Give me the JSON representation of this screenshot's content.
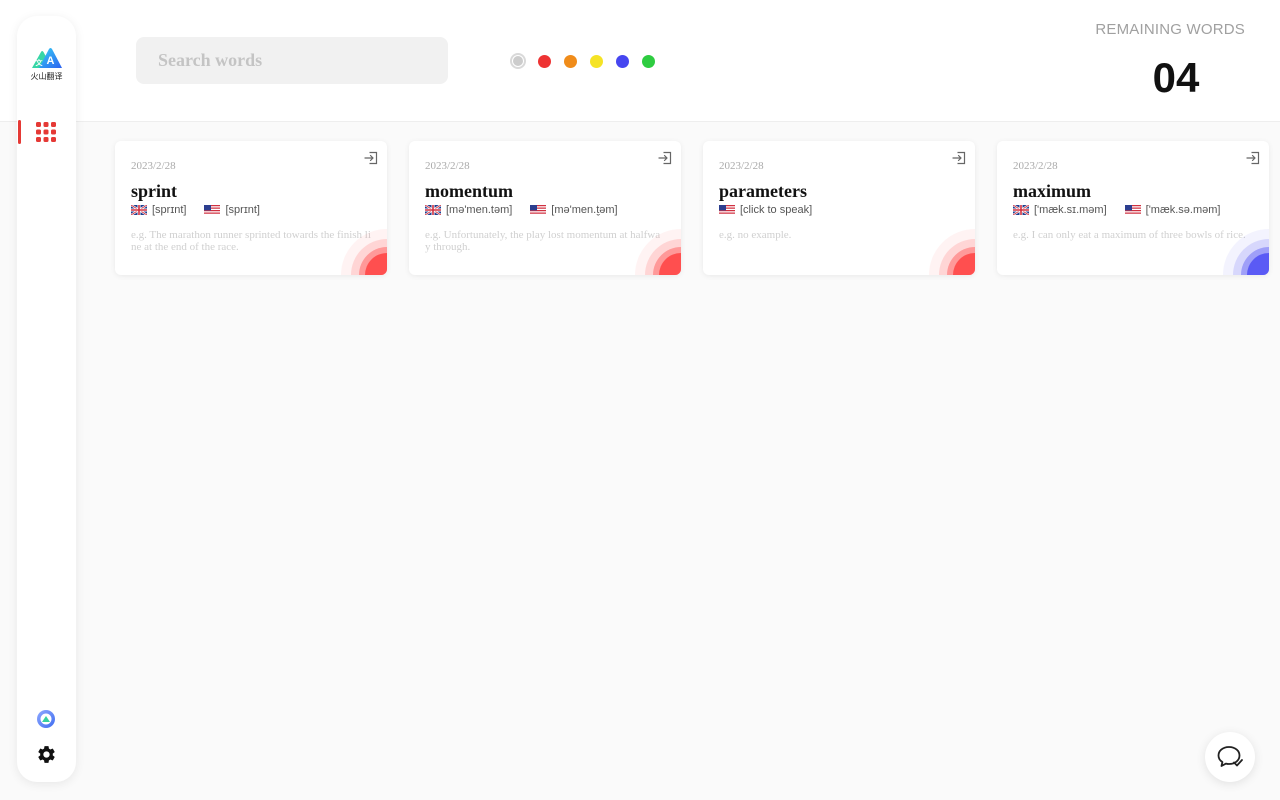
{
  "app": {
    "logo_text": "火山翻译"
  },
  "search": {
    "placeholder": "Search words",
    "value": ""
  },
  "color_filters": [
    {
      "name": "all",
      "color": "#cccccc",
      "selected": true
    },
    {
      "name": "red",
      "color": "#ee3333",
      "selected": false
    },
    {
      "name": "orange",
      "color": "#f08c1a",
      "selected": false
    },
    {
      "name": "yellow",
      "color": "#f5e325",
      "selected": false
    },
    {
      "name": "blue",
      "color": "#4646f0",
      "selected": false
    },
    {
      "name": "green",
      "color": "#2ecc40",
      "selected": false
    }
  ],
  "remaining": {
    "label": "REMAINING WORDS",
    "count": "04"
  },
  "sidebar": {
    "items": [
      {
        "name": "word-grid",
        "icon": "grid-icon",
        "active": true
      }
    ],
    "bottom": [
      {
        "icon": "volcano-logo-icon"
      },
      {
        "icon": "gear-icon"
      }
    ]
  },
  "cards": [
    {
      "date": "2023/2/28",
      "word": "sprint",
      "uk": "[sprɪnt]",
      "us": "[sprɪnt]",
      "example": "e.g. The marathon runner sprinted towards the finish line at the end of the race.",
      "accent": "#ff4f4f"
    },
    {
      "date": "2023/2/28",
      "word": "momentum",
      "uk": "[mə'men.təm]",
      "us": "[mə'men.t̬əm]",
      "example": "e.g. Unfortunately, the play lost momentum at halfway through.",
      "accent": "#ff4f4f"
    },
    {
      "date": "2023/2/28",
      "word": "parameters",
      "us": "[click to speak]",
      "example": "e.g. no example.",
      "accent": "#ff4f4f"
    },
    {
      "date": "2023/2/28",
      "word": "maximum",
      "uk": "['mæk.sɪ.məm]",
      "us": "['mæk.sə.məm]",
      "example": "e.g. I can only eat a maximum of three bowls of rice.",
      "accent": "#5a5af5"
    }
  ],
  "icons": {
    "card_action": "exit-to-app-icon",
    "chat": "chat-bubble-icon",
    "flag_uk": "uk-flag-icon",
    "flag_us": "us-flag-icon"
  }
}
